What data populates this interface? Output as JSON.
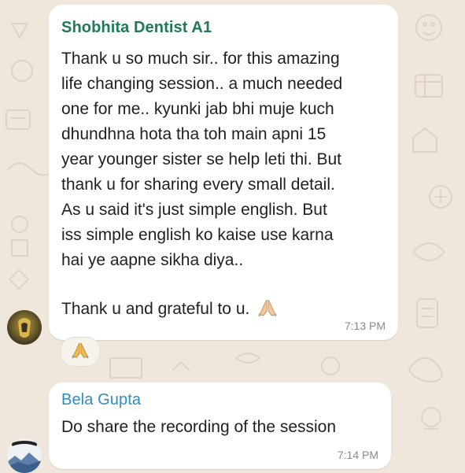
{
  "messages": [
    {
      "sender": "Shobhita Dentist A1",
      "text": "Thank u so much sir.. for this amazing\nlife changing session.. a much needed\none for me..  kyunki jab bhi muje kuch\ndhundhna hota tha toh main apni 15\nyear younger sister se help leti thi. But\nthank u for sharing  every small detail.\nAs u said it's just simple english. But\niss simple english ko kaise use karna\nhai ye aapne sikha diya..\nThank u and grateful to u.",
      "time": "7:13 PM",
      "sender_color": "#1f7a55",
      "inline_emoji": "folded-hands-icon",
      "reaction": "folded-hands-icon"
    },
    {
      "sender": "Bela Gupta",
      "text": "Do share the recording of the session",
      "time": "7:14 PM",
      "sender_color": "#2f8cc0"
    }
  ],
  "colors": {
    "background": "#efe7dc",
    "bubble": "#ffffff",
    "timestamp": "#8a8a8a"
  }
}
